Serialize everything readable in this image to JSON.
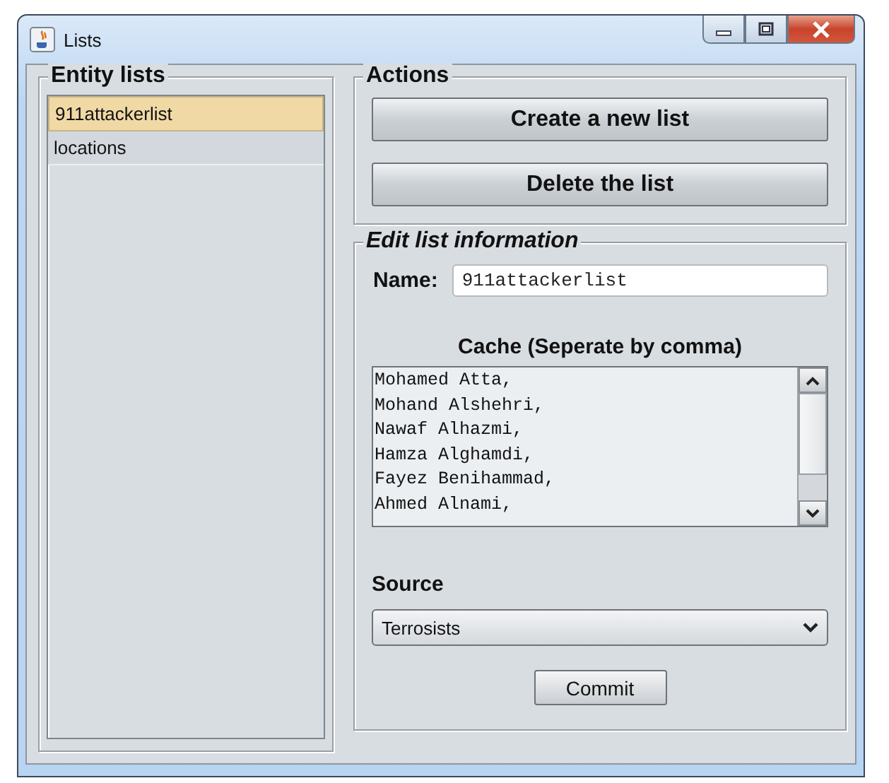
{
  "window": {
    "title": "Lists"
  },
  "entity_lists": {
    "title": "Entity lists",
    "items": [
      {
        "label": "911attackerlist",
        "selected": true
      },
      {
        "label": "locations",
        "selected": false
      }
    ]
  },
  "actions": {
    "title": "Actions",
    "buttons": [
      "Create a new list",
      "Delete the list"
    ]
  },
  "edit": {
    "title": "Edit list information",
    "name_label": "Name:",
    "name_value": "911attackerlist",
    "cache_label": "Cache (Seperate by comma)",
    "cache_lines": [
      "Mohamed Atta,",
      "Mohand Alshehri,",
      "Nawaf Alhazmi,",
      "Hamza Alghamdi,",
      "Fayez Benihammad,",
      "Ahmed Alnami,"
    ],
    "source_label": "Source",
    "source_value": "Terrosists",
    "commit": "Commit"
  }
}
